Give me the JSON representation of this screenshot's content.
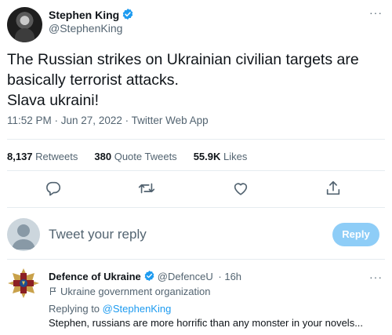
{
  "tweet": {
    "author_name": "Stephen King",
    "author_handle": "@StephenKing",
    "more_label": "···",
    "text_lines": [
      "The Russian strikes on Ukrainian civilian targets are",
      "basically terrorist attacks.",
      "Slava ukraini!"
    ],
    "timestamp": "11:52 PM · Jun 27, 2022 · Twitter Web App",
    "stats": {
      "retweets_count": "8,137",
      "retweets_label": "Retweets",
      "quotes_count": "380",
      "quotes_label": "Quote Tweets",
      "likes_count": "55.9K",
      "likes_label": "Likes"
    },
    "icons": [
      "reply-icon",
      "retweet-icon",
      "like-icon",
      "share-icon"
    ]
  },
  "compose": {
    "placeholder": "Tweet your reply",
    "button_label": "Reply"
  },
  "reply": {
    "author_name": "Defence of Ukraine",
    "author_handle": "@DefenceU",
    "time": "· 16h",
    "org_label": "Ukraine government organization",
    "replying_prefix": "Replying to",
    "replying_to": "@StephenKing",
    "text": "Stephen, russians are more horrific than any monster in your novels...",
    "more_label": "···"
  },
  "colors": {
    "accent": "#1d9bf0",
    "reply_button": "#8ecdf7",
    "secondary_text": "#536471",
    "verified": "#1d9bf0"
  }
}
